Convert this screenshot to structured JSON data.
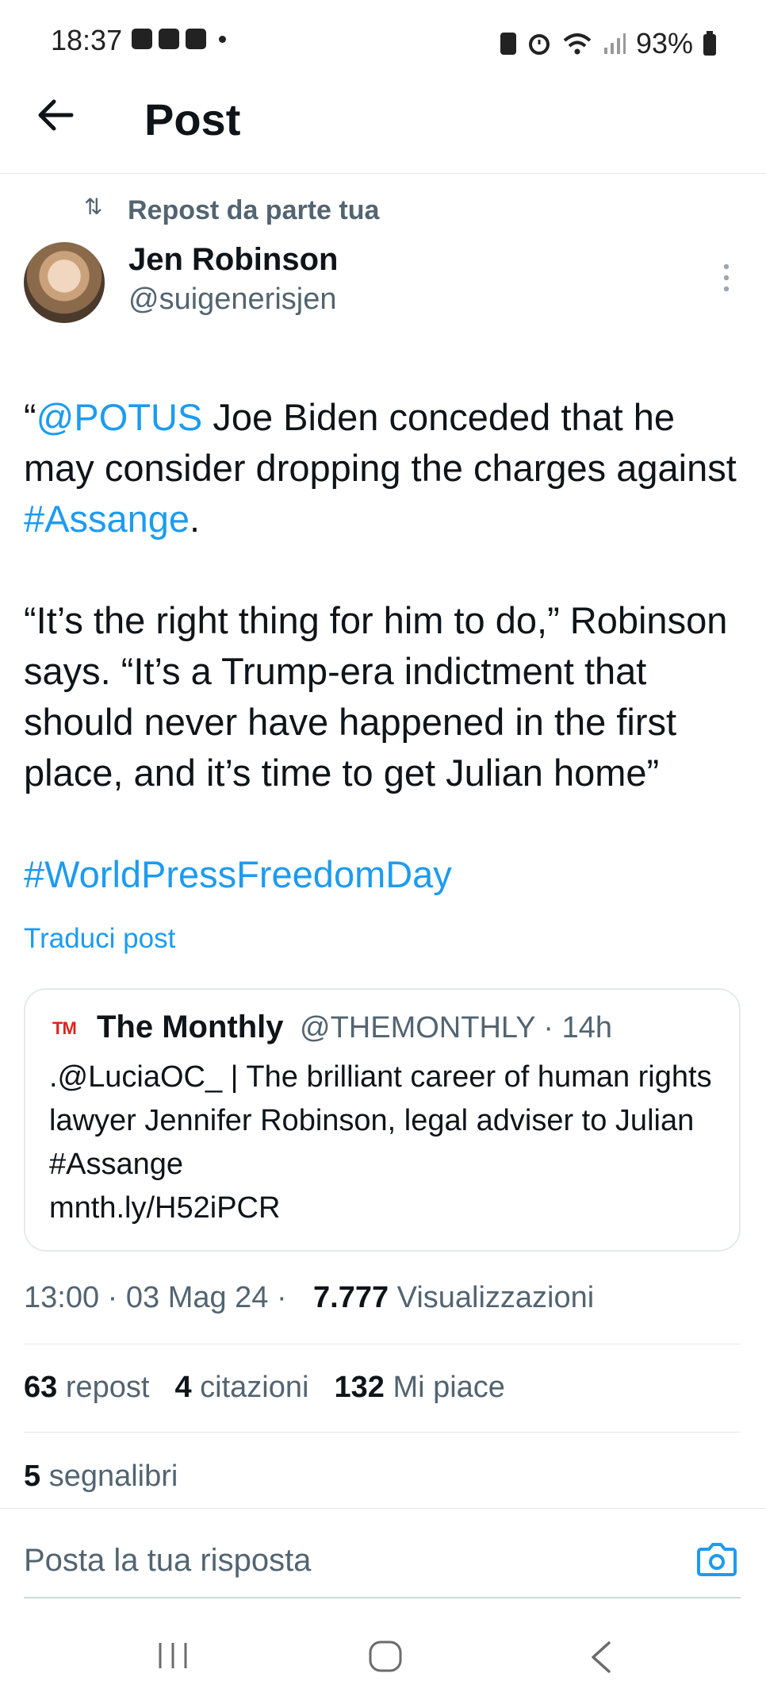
{
  "status_bar": {
    "time": "18:37",
    "battery": "93%"
  },
  "header": {
    "title": "Post"
  },
  "post": {
    "repost_label": "Repost da parte tua",
    "author_name": "Jen Robinson",
    "author_handle": "@suigenerisjen",
    "text_parts": [
      {
        "text": "“",
        "link": false
      },
      {
        "text": "@POTUS",
        "link": true
      },
      {
        "text": " Joe Biden conceded that he may consider dropping the charges against ",
        "link": false
      },
      {
        "text": "#Assange",
        "link": true
      },
      {
        "text": ".\n\n“It’s the right thing for him to do,” Robinson says. “It’s a Trump-era indictment that should never have happened in the first place, and it’s time to get Julian home”\n\n",
        "link": false
      },
      {
        "text": "#WorldPressFreedomDay",
        "link": true
      }
    ],
    "translate_label": "Traduci post",
    "quoted": {
      "logo": "TM",
      "name": "The Monthly",
      "meta": "@THEMONTHLY · 14h",
      "text": ".@LuciaOC_ | The brilliant career of human rights lawyer Jennifer Robinson, legal adviser to Julian #Assange\nmnth.ly/H52iPCR"
    },
    "timestamp": "13:00 · 03 Mag 24 ·",
    "views_count": "7.777",
    "views_label": "Visualizzazioni",
    "stats": {
      "reposts_count": "63",
      "reposts_label": "repost",
      "quotes_count": "4",
      "quotes_label": "citazioni",
      "likes_count": "132",
      "likes_label": "Mi piace",
      "bookmarks_count": "5",
      "bookmarks_label": "segnalibri"
    }
  },
  "reply": {
    "placeholder": "Posta la tua risposta"
  },
  "colors": {
    "link": "#1d9bf0",
    "secondary_text": "#536471",
    "brand_red": "#e0241b"
  }
}
